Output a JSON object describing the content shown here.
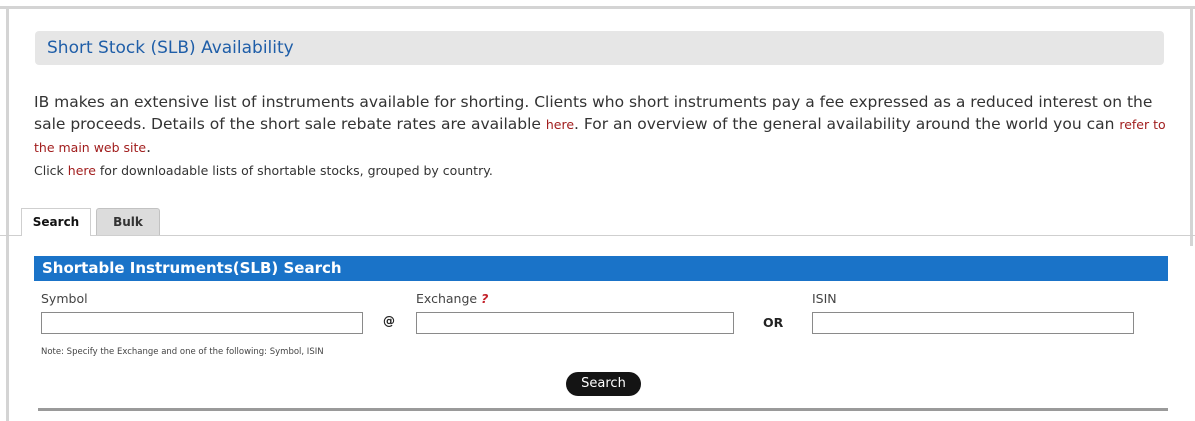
{
  "page": {
    "title": "Short Stock (SLB) Availability"
  },
  "intro": {
    "text_before_link1": "IB makes an extensive list of instruments available for shorting. Clients who short instruments pay a fee expressed as a reduced interest on the sale proceeds. Details of the short sale rebate rates are available ",
    "link1": "here",
    "text_after_link1": ". For an overview of the general availability around the world you can ",
    "link2": "refer to the main web site",
    "text_end": ".",
    "click_prefix": "Click ",
    "click_link": "here",
    "click_suffix": " for downloadable lists of shortable stocks, grouped by country."
  },
  "tabs": [
    {
      "label": "Search",
      "active": true
    },
    {
      "label": "Bulk",
      "active": false
    }
  ],
  "search_panel": {
    "header": "Shortable Instruments(SLB) Search",
    "symbol_label": "Symbol",
    "symbol_value": "",
    "at_sign": "@",
    "exchange_label": "Exchange",
    "exchange_help_icon": "?",
    "exchange_value": "",
    "or_label": "OR",
    "isin_label": "ISIN",
    "isin_value": "",
    "note": "Note: Specify the Exchange and one of the following: Symbol, ISIN",
    "search_button": "Search"
  },
  "colors": {
    "title_text": "#1f5ea8",
    "panel_header_bg": "#1a73c8",
    "link": "#a11d1d",
    "help_icon": "#c4232b",
    "button_bg": "#141414"
  }
}
